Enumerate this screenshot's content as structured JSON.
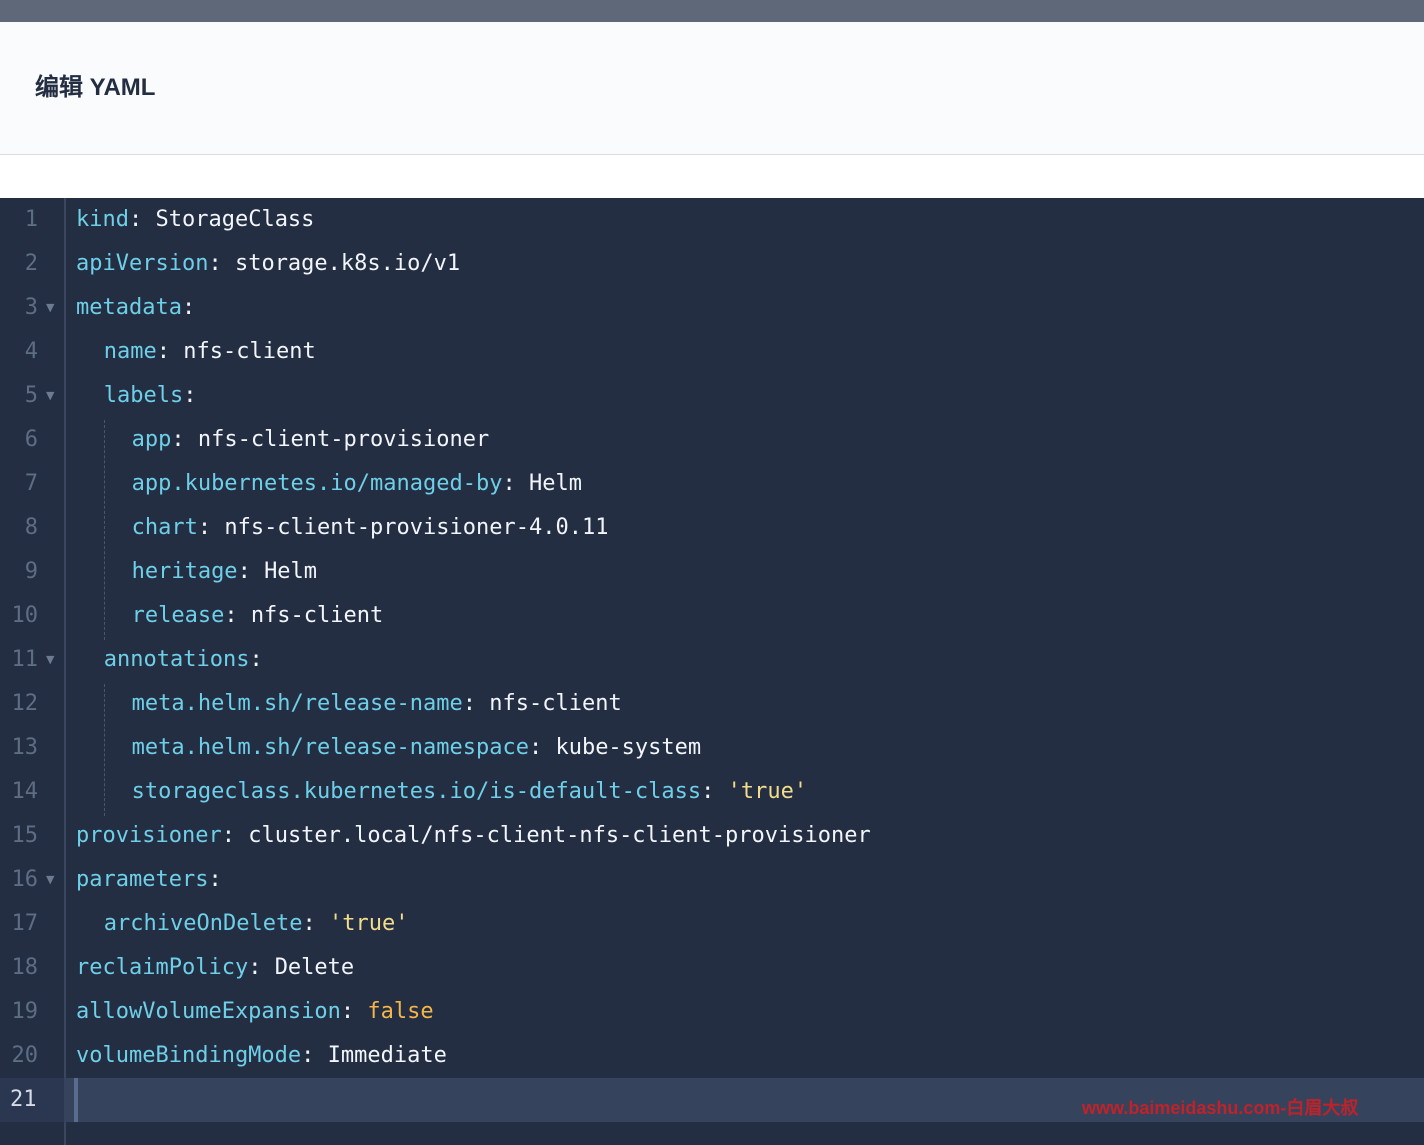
{
  "dialog": {
    "title": "编辑 YAML"
  },
  "editor": {
    "lines": [
      {
        "num": "1",
        "key": "kind",
        "value": "StorageClass",
        "value_type": "plain"
      },
      {
        "num": "2",
        "key": "apiVersion",
        "value": "storage.k8s.io/v1",
        "value_type": "plain"
      },
      {
        "num": "3",
        "key": "metadata",
        "value": "",
        "value_type": "plain",
        "fold": "▼"
      },
      {
        "num": "4",
        "key": "name",
        "value": "nfs-client",
        "value_type": "plain"
      },
      {
        "num": "5",
        "key": "labels",
        "value": "",
        "value_type": "plain",
        "fold": "▼"
      },
      {
        "num": "6",
        "key": "app",
        "value": "nfs-client-provisioner",
        "value_type": "plain"
      },
      {
        "num": "7",
        "key": "app.kubernetes.io/managed-by",
        "value": "Helm",
        "value_type": "plain"
      },
      {
        "num": "8",
        "key": "chart",
        "value": "nfs-client-provisioner-4.0.11",
        "value_type": "plain"
      },
      {
        "num": "9",
        "key": "heritage",
        "value": "Helm",
        "value_type": "plain"
      },
      {
        "num": "10",
        "key": "release",
        "value": "nfs-client",
        "value_type": "plain"
      },
      {
        "num": "11",
        "key": "annotations",
        "value": "",
        "value_type": "plain",
        "fold": "▼"
      },
      {
        "num": "12",
        "key": "meta.helm.sh/release-name",
        "value": "nfs-client",
        "value_type": "plain"
      },
      {
        "num": "13",
        "key": "meta.helm.sh/release-namespace",
        "value": "kube-system",
        "value_type": "plain"
      },
      {
        "num": "14",
        "key": "storageclass.kubernetes.io/is-default-class",
        "value": "'true'",
        "value_type": "string"
      },
      {
        "num": "15",
        "key": "provisioner",
        "value": "cluster.local/nfs-client-nfs-client-provisioner",
        "value_type": "plain"
      },
      {
        "num": "16",
        "key": "parameters",
        "value": "",
        "value_type": "plain",
        "fold": "▼"
      },
      {
        "num": "17",
        "key": "archiveOnDelete",
        "value": "'true'",
        "value_type": "string"
      },
      {
        "num": "18",
        "key": "reclaimPolicy",
        "value": "Delete",
        "value_type": "plain"
      },
      {
        "num": "19",
        "key": "allowVolumeExpansion",
        "value": "false",
        "value_type": "boolean"
      },
      {
        "num": "20",
        "key": "volumeBindingMode",
        "value": "Immediate",
        "value_type": "plain"
      },
      {
        "num": "21",
        "key": "",
        "value": "",
        "value_type": "plain",
        "active": true
      }
    ],
    "colors": {
      "background": "#242e42",
      "key": "#6ecfe8",
      "value": "#f2f5fa",
      "string": "#f3dc8c",
      "boolean": "#f5b547",
      "line_number": "#5d6d84"
    }
  },
  "watermark": {
    "text": "www.baimeidashu.com-白眉大叔"
  }
}
